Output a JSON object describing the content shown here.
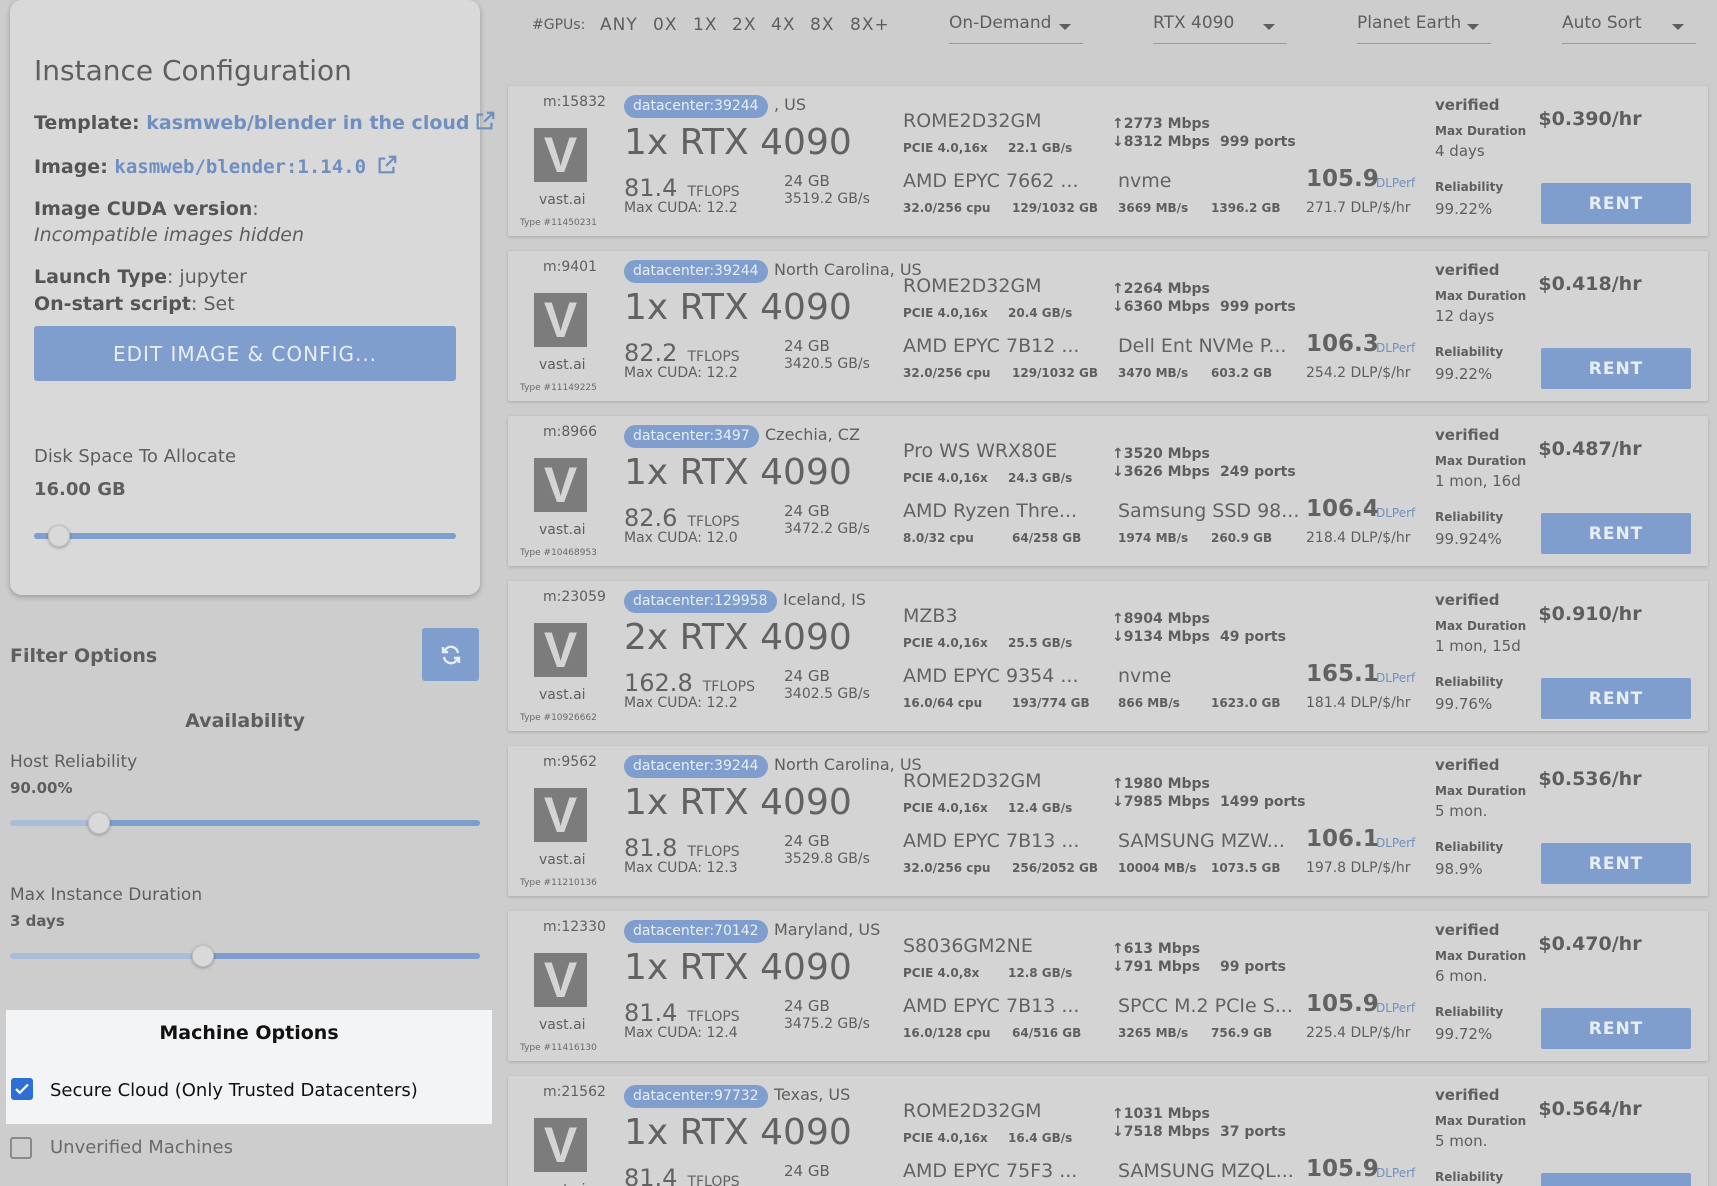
{
  "sidebar": {
    "config_title": "Instance Configuration",
    "template_label": "Template",
    "template_value": "kasmweb/blender in the cloud",
    "image_label": "Image",
    "image_value": "kasmweb/blender:1.14.0",
    "cuda_label": "Image CUDA version",
    "cuda_value": "Incompatible images hidden",
    "launch_label": "Launch Type",
    "launch_value": "jupyter",
    "onstart_label": "On-start script",
    "onstart_value": "Set",
    "edit_button": "EDIT IMAGE & CONFIG...",
    "disk_label": "Disk Space To Allocate",
    "disk_value": "16.00 GB",
    "disk_slider_fraction": 0.06,
    "filter_title": "Filter Options",
    "availability_title": "Availability",
    "host_reliability_label": "Host Reliability",
    "host_reliability_value": "90.00%",
    "host_reliability_fraction": 0.19,
    "max_duration_label": "Max Instance Duration",
    "max_duration_value": "3 days",
    "max_duration_fraction": 0.41,
    "machine_options_title": "Machine Options",
    "secure_cloud_label": "Secure Cloud (Only Trusted Datacenters)",
    "secure_cloud_checked": true,
    "unverified_label": "Unverified Machines",
    "unverified_checked": false
  },
  "topbar": {
    "gpus_label": "#GPUs:",
    "gpu_options": [
      "ANY",
      "0X",
      "1X",
      "2X",
      "4X",
      "8X",
      "8X+"
    ],
    "rental_type": "On-Demand",
    "gpu_model": "RTX 4090",
    "region": "Planet Earth",
    "sort": "Auto Sort"
  },
  "accent_color": "#7f9ece",
  "offers": [
    {
      "machine": "m:15832",
      "brand": "vast.ai",
      "type_id": "Type #11450231",
      "datacenter": "datacenter:39244",
      "location": ", US",
      "gpu": "1x RTX 4090",
      "tflops": "81.4",
      "tflops_unit": "TFLOPS",
      "max_cuda": "Max CUDA: 12.2",
      "vram": "24 GB",
      "vram_bw": "3519.2 GB/s",
      "motherboard": "ROME2D32GM",
      "pcie": "PCIE 4.0,16x",
      "pcie_bw": "22.1 GB/s",
      "cpu": "AMD EPYC 7662 ...",
      "cpu_cores": "32.0/256 cpu",
      "ram": "129/1032 GB",
      "upload": "2773 Mbps",
      "download": "8312 Mbps",
      "ports": "999 ports",
      "disk": "nvme",
      "disk_bw": "3669 MB/s",
      "disk_size": "1396.2 GB",
      "dlperf": "105.9",
      "dlperf_label": "DLPerf",
      "dlperf_per_dollar": "271.7 DLP/$/hr",
      "verified": "verified",
      "max_duration_label": "Max Duration",
      "max_duration": "4 days",
      "reliability_label": "Reliability",
      "reliability": "99.22%",
      "price": "$0.390/hr",
      "rent_label": "RENT"
    },
    {
      "machine": "m:9401",
      "brand": "vast.ai",
      "type_id": "Type #11149225",
      "datacenter": "datacenter:39244",
      "location": "North Carolina, US",
      "gpu": "1x RTX 4090",
      "tflops": "82.2",
      "tflops_unit": "TFLOPS",
      "max_cuda": "Max CUDA: 12.2",
      "vram": "24 GB",
      "vram_bw": "3420.5 GB/s",
      "motherboard": "ROME2D32GM",
      "pcie": "PCIE 4.0,16x",
      "pcie_bw": "20.4 GB/s",
      "cpu": "AMD EPYC 7B12 ...",
      "cpu_cores": "32.0/256 cpu",
      "ram": "129/1032 GB",
      "upload": "2264 Mbps",
      "download": "6360 Mbps",
      "ports": "999 ports",
      "disk": "Dell Ent NVMe P...",
      "disk_bw": "3470 MB/s",
      "disk_size": "603.2 GB",
      "dlperf": "106.3",
      "dlperf_label": "DLPerf",
      "dlperf_per_dollar": "254.2 DLP/$/hr",
      "verified": "verified",
      "max_duration_label": "Max Duration",
      "max_duration": "12 days",
      "reliability_label": "Reliability",
      "reliability": "99.22%",
      "price": "$0.418/hr",
      "rent_label": "RENT"
    },
    {
      "machine": "m:8966",
      "brand": "vast.ai",
      "type_id": "Type #10468953",
      "datacenter": "datacenter:3497",
      "location": "Czechia, CZ",
      "gpu": "1x RTX 4090",
      "tflops": "82.6",
      "tflops_unit": "TFLOPS",
      "max_cuda": "Max CUDA: 12.0",
      "vram": "24 GB",
      "vram_bw": "3472.2 GB/s",
      "motherboard": "Pro WS WRX80E",
      "pcie": "PCIE 4.0,16x",
      "pcie_bw": "24.3 GB/s",
      "cpu": "AMD Ryzen Thre...",
      "cpu_cores": "8.0/32 cpu",
      "ram": "64/258 GB",
      "upload": "3520 Mbps",
      "download": "3626 Mbps",
      "ports": "249 ports",
      "disk": "Samsung SSD 98...",
      "disk_bw": "1974 MB/s",
      "disk_size": "260.9 GB",
      "dlperf": "106.4",
      "dlperf_label": "DLPerf",
      "dlperf_per_dollar": "218.4 DLP/$/hr",
      "verified": "verified",
      "max_duration_label": "Max Duration",
      "max_duration": "1 mon, 16d",
      "reliability_label": "Reliability",
      "reliability": "99.924%",
      "price": "$0.487/hr",
      "rent_label": "RENT"
    },
    {
      "machine": "m:23059",
      "brand": "vast.ai",
      "type_id": "Type #10926662",
      "datacenter": "datacenter:129958",
      "location": "Iceland, IS",
      "gpu": "2x RTX 4090",
      "tflops": "162.8",
      "tflops_unit": "TFLOPS",
      "max_cuda": "Max CUDA: 12.2",
      "vram": "24 GB",
      "vram_bw": "3402.5 GB/s",
      "motherboard": "MZB3",
      "pcie": "PCIE 4.0,16x",
      "pcie_bw": "25.5 GB/s",
      "cpu": "AMD EPYC 9354 ...",
      "cpu_cores": "16.0/64 cpu",
      "ram": "193/774 GB",
      "upload": "8904 Mbps",
      "download": "9134 Mbps",
      "ports": "49 ports",
      "disk": "nvme",
      "disk_bw": "866 MB/s",
      "disk_size": "1623.0 GB",
      "dlperf": "165.1",
      "dlperf_label": "DLPerf",
      "dlperf_per_dollar": "181.4 DLP/$/hr",
      "verified": "verified",
      "max_duration_label": "Max Duration",
      "max_duration": "1 mon, 15d",
      "reliability_label": "Reliability",
      "reliability": "99.76%",
      "price": "$0.910/hr",
      "rent_label": "RENT"
    },
    {
      "machine": "m:9562",
      "brand": "vast.ai",
      "type_id": "Type #11210136",
      "datacenter": "datacenter:39244",
      "location": "North Carolina, US",
      "gpu": "1x RTX 4090",
      "tflops": "81.8",
      "tflops_unit": "TFLOPS",
      "max_cuda": "Max CUDA: 12.3",
      "vram": "24 GB",
      "vram_bw": "3529.8 GB/s",
      "motherboard": "ROME2D32GM",
      "pcie": "PCIE 4.0,16x",
      "pcie_bw": "12.4 GB/s",
      "cpu": "AMD EPYC 7B13 ...",
      "cpu_cores": "32.0/256 cpu",
      "ram": "256/2052 GB",
      "upload": "1980 Mbps",
      "download": "7985 Mbps",
      "ports": "1499 ports",
      "disk": "SAMSUNG MZW...",
      "disk_bw": "10004 MB/s",
      "disk_size": "1073.5 GB",
      "dlperf": "106.1",
      "dlperf_label": "DLPerf",
      "dlperf_per_dollar": "197.8 DLP/$/hr",
      "verified": "verified",
      "max_duration_label": "Max Duration",
      "max_duration": "5 mon.",
      "reliability_label": "Reliability",
      "reliability": "98.9%",
      "price": "$0.536/hr",
      "rent_label": "RENT"
    },
    {
      "machine": "m:12330",
      "brand": "vast.ai",
      "type_id": "Type #11416130",
      "datacenter": "datacenter:70142",
      "location": "Maryland, US",
      "gpu": "1x RTX 4090",
      "tflops": "81.4",
      "tflops_unit": "TFLOPS",
      "max_cuda": "Max CUDA: 12.4",
      "vram": "24 GB",
      "vram_bw": "3475.2 GB/s",
      "motherboard": "S8036GM2NE",
      "pcie": "PCIE 4.0,8x",
      "pcie_bw": "12.8 GB/s",
      "cpu": "AMD EPYC 7B13 ...",
      "cpu_cores": "16.0/128 cpu",
      "ram": "64/516 GB",
      "upload": "613 Mbps",
      "download": "791 Mbps",
      "ports": "99 ports",
      "disk": "SPCC M.2 PCIe S...",
      "disk_bw": "3265 MB/s",
      "disk_size": "756.9 GB",
      "dlperf": "105.9",
      "dlperf_label": "DLPerf",
      "dlperf_per_dollar": "225.4 DLP/$/hr",
      "verified": "verified",
      "max_duration_label": "Max Duration",
      "max_duration": "6 mon.",
      "reliability_label": "Reliability",
      "reliability": "99.72%",
      "price": "$0.470/hr",
      "rent_label": "RENT"
    },
    {
      "machine": "m:21562",
      "brand": "vast.ai",
      "type_id": "",
      "datacenter": "datacenter:97732",
      "location": "Texas, US",
      "gpu": "1x RTX 4090",
      "tflops": "81.4",
      "tflops_unit": "TFLOPS",
      "max_cuda": "",
      "vram": "24 GB",
      "vram_bw": "",
      "motherboard": "ROME2D32GM",
      "pcie": "PCIE 4.0,16x",
      "pcie_bw": "16.4 GB/s",
      "cpu": "AMD EPYC 75F3 ...",
      "cpu_cores": "",
      "ram": "",
      "upload": "1031 Mbps",
      "download": "7518 Mbps",
      "ports": "37 ports",
      "disk": "SAMSUNG MZQL...",
      "disk_bw": "",
      "disk_size": "",
      "dlperf": "105.9",
      "dlperf_label": "DLPerf",
      "dlperf_per_dollar": "",
      "verified": "verified",
      "max_duration_label": "Max Duration",
      "max_duration": "5 mon.",
      "reliability_label": "Reliability",
      "reliability": "",
      "price": "$0.564/hr",
      "rent_label": "RENT"
    }
  ]
}
